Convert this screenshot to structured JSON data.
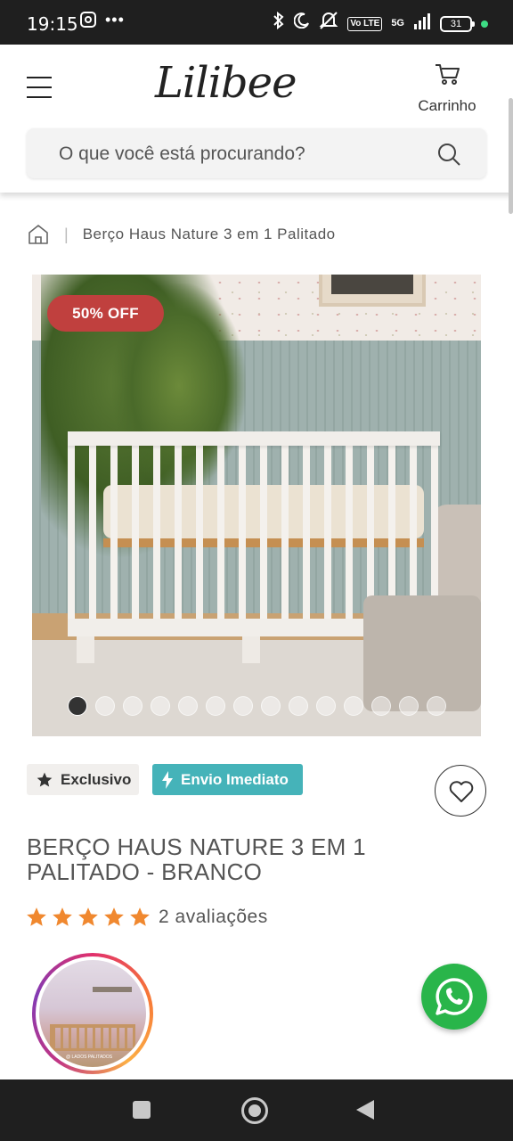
{
  "status_bar": {
    "time": "19:15",
    "more_icons": "•••",
    "network": "5G",
    "volte": "Vo LTE",
    "battery": "31"
  },
  "header": {
    "logo_text": "Lilibee",
    "cart_label": "Carrinho",
    "search_placeholder": "O que você está procurando?"
  },
  "breadcrumb": {
    "separator": "|",
    "current": "Berço Haus Nature 3 em 1 Palitado"
  },
  "product": {
    "discount_badge": "50% OFF",
    "image_dots_count": 14,
    "active_dot_index": 0,
    "tags": {
      "exclusive": "Exclusivo",
      "shipping": "Envio Imediato"
    },
    "title": "BERÇO HAUS NATURE 3 EM 1 PALITADO - BRANCO",
    "rating_stars": 5,
    "rating_text": "2 avaliações",
    "story_caption": "@ LADOS PALITADOS"
  },
  "colors": {
    "discount_red": "#c0403e",
    "shipping_teal": "#45b3b9",
    "star_orange": "#f0882f",
    "whatsapp_green": "#29b54a"
  }
}
